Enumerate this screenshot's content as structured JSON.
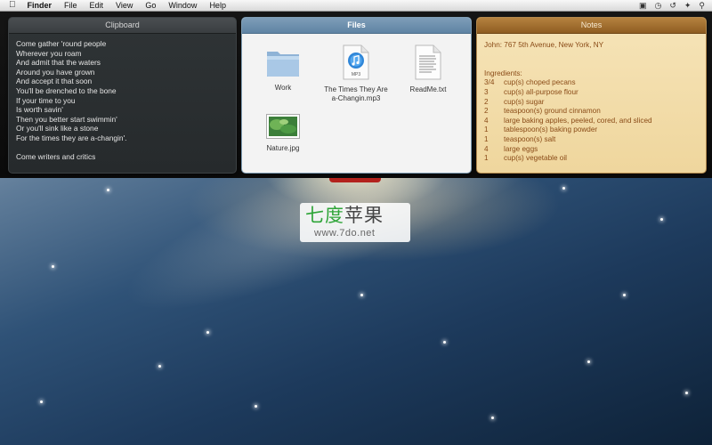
{
  "menubar": {
    "items": [
      "Finder",
      "File",
      "Edit",
      "View",
      "Go",
      "Window",
      "Help"
    ]
  },
  "clipboard": {
    "title": "Clipboard",
    "lines": [
      "Come gather 'round people",
      "Wherever you roam",
      "And admit that the waters",
      "Around you have grown",
      "And accept it that soon",
      "You'll be drenched to the bone",
      "If your time to you",
      "Is worth savin'",
      "Then you better start swimmin'",
      "Or you'll sink like a stone",
      "For the times they are a-changin'.",
      "",
      "Come writers and critics"
    ]
  },
  "files": {
    "title": "Files",
    "items": [
      {
        "name": "Work",
        "icon": "folder-icon"
      },
      {
        "name": "The Times They Are a-Changin.mp3",
        "icon": "mp3-icon",
        "badge": "MP3"
      },
      {
        "name": "ReadMe.txt",
        "icon": "text-document-icon"
      },
      {
        "name": "Nature.jpg",
        "icon": "image-icon"
      }
    ]
  },
  "notes": {
    "title": "Notes",
    "address": "John: 767 5th Avenue, New York, NY",
    "ingredients_label": "Ingredients:",
    "ingredients": [
      {
        "qty": "3/4",
        "item": "cup(s) choped pecans"
      },
      {
        "qty": "3",
        "item": "cup(s) all-purpose flour"
      },
      {
        "qty": "2",
        "item": "cup(s) sugar"
      },
      {
        "qty": "2",
        "item": "teaspoon(s) ground cinnamon"
      },
      {
        "qty": "4",
        "item": "large baking apples, peeled, cored, and sliced"
      },
      {
        "qty": "1",
        "item": "tablespoon(s) baking powder"
      },
      {
        "qty": "1",
        "item": "teaspoon(s) salt"
      },
      {
        "qty": "4",
        "item": "large eggs"
      },
      {
        "qty": "1",
        "item": "cup(s) vegetable oil"
      }
    ]
  },
  "watermark": {
    "cn_green": "七度",
    "cn_dark": "苹果",
    "url": "www.7do.net"
  },
  "colors": {
    "files_header": "#6f91ae",
    "notes_text": "#8a4b17",
    "red_tab": "#b3221d",
    "watermark_green": "#2fa539"
  }
}
